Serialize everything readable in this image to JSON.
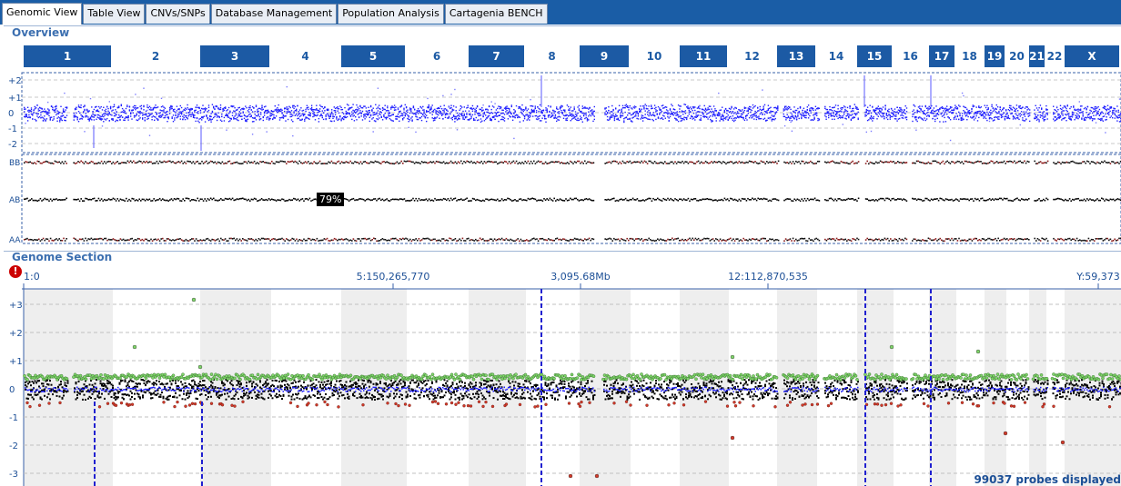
{
  "tabs": [
    {
      "label": "Genomic View",
      "active": true
    },
    {
      "label": "Table View",
      "active": false
    },
    {
      "label": "CNVs/SNPs",
      "active": false
    },
    {
      "label": "Database Management",
      "active": false
    },
    {
      "label": "Population Analysis",
      "active": false
    },
    {
      "label": "Cartagenia BENCH",
      "active": false
    }
  ],
  "overview": {
    "title": "Overview",
    "chromosomes": [
      "1",
      "2",
      "3",
      "4",
      "5",
      "6",
      "7",
      "8",
      "9",
      "10",
      "11",
      "12",
      "13",
      "14",
      "15",
      "16",
      "17",
      "18",
      "19",
      "20",
      "21",
      "22",
      "X"
    ],
    "lrr_ticks": [
      "+2",
      "+1",
      "0",
      "-1",
      "-2"
    ],
    "baf_labels": [
      "BB",
      "AB",
      "AA"
    ],
    "overlay_percent": "79%"
  },
  "genome_section": {
    "title": "Genome Section",
    "alert_icon": "exclamation-icon",
    "position_labels": [
      "1:0",
      "5:150,265,770",
      "3,095.68Mb",
      "12:112,870,535",
      "Y:59,373"
    ],
    "y_ticks": [
      "+3",
      "+2",
      "+1",
      "0",
      "-1",
      "-2",
      "-3"
    ],
    "probes_text": "99037 probes displayed"
  },
  "colors": {
    "tab_bar": "#1a5da6",
    "chrom_dark": "#1c5aa4",
    "lrr_points": "#1f1fff",
    "baf_points": "#000000",
    "gain_points": "#7fd46a",
    "loss_points": "#d23a2a",
    "band_shade": "#eeeeee"
  }
}
